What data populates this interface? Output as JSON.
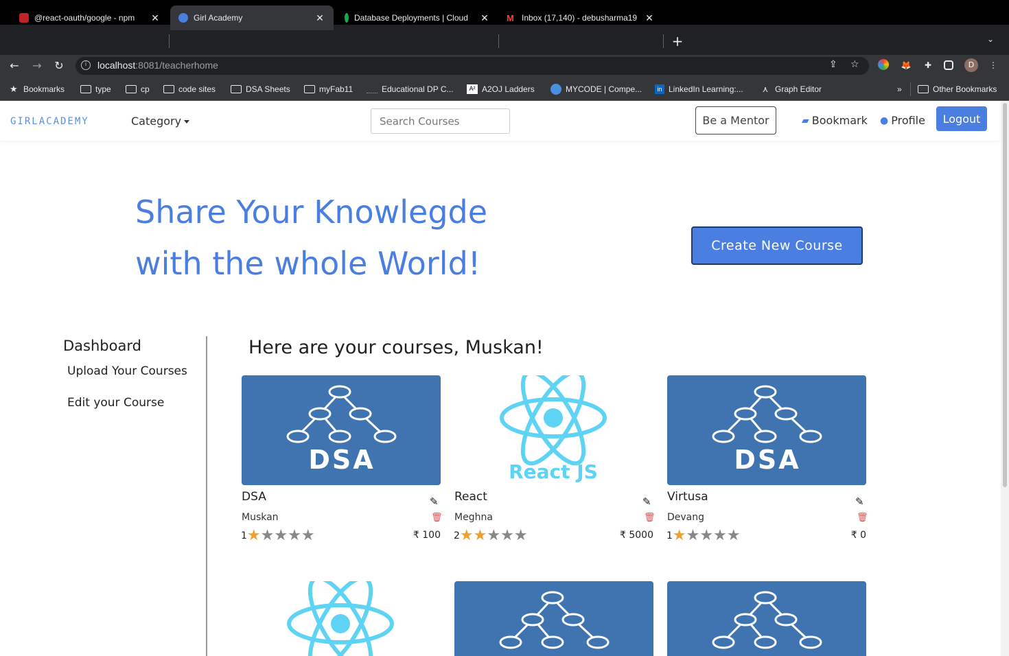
{
  "browser": {
    "tabs": [
      {
        "title": "@react-oauth/google - npm",
        "fav_color": "#c12127",
        "active": false
      },
      {
        "title": "Girl Academy",
        "fav_color": "#4a7ee0",
        "active": true
      },
      {
        "title": "Database Deployments | Cloud",
        "fav_color": "#13aa52",
        "active": false
      },
      {
        "title": "Inbox (17,140) - debusharma19",
        "fav_color": "#ea4335",
        "active": false
      }
    ],
    "url_host": "localhost",
    "url_path": ":8081/teacherhome",
    "profile_initial": "D",
    "bookmarks": [
      {
        "label": "Bookmarks",
        "icon": "star-icon"
      },
      {
        "label": "type",
        "icon": "folder-icon"
      },
      {
        "label": "cp",
        "icon": "folder-icon"
      },
      {
        "label": "code sites",
        "icon": "folder-icon"
      },
      {
        "label": "DSA Sheets",
        "icon": "folder-icon"
      },
      {
        "label": "myFab11",
        "icon": "folder-icon"
      },
      {
        "label": "Educational DP C...",
        "icon": "site-icon"
      },
      {
        "label": "A2OJ Ladders",
        "icon": "site-icon"
      },
      {
        "label": "MYCODE | Compe...",
        "icon": "site-icon"
      },
      {
        "label": "LinkedIn Learning:...",
        "icon": "linkedin-icon"
      },
      {
        "label": "Graph Editor",
        "icon": "graph-icon"
      },
      {
        "label": "Other Bookmarks",
        "icon": "folder-icon"
      }
    ],
    "more_bookmarks": "»"
  },
  "nav": {
    "logo": "GIRLACADEMY",
    "category": "Category",
    "search_placeholder": "Search Courses",
    "mentor": "Be a Mentor",
    "bookmark": "Bookmark",
    "profile": "Profile",
    "logout": "Logout"
  },
  "hero": {
    "line1": "Share Your Knowlegde",
    "line2": "with the whole World!",
    "create_button": "Create New Course"
  },
  "sidebar": {
    "title": "Dashboard",
    "items": [
      "Upload Your Courses",
      "Edit your Course"
    ]
  },
  "courses": {
    "heading": "Here are your courses, Muskan!",
    "items": [
      {
        "title": "DSA",
        "author": "Muskan",
        "rating": "1",
        "stars": 1,
        "price": "₹ 100",
        "image": "dsa"
      },
      {
        "title": "React",
        "author": "Meghna",
        "rating": "2",
        "stars": 2,
        "price": "₹ 5000",
        "image": "react"
      },
      {
        "title": "Virtusa",
        "author": "Devang",
        "rating": "1",
        "stars": 1,
        "price": "₹ 0",
        "image": "dsa"
      }
    ],
    "image_text": {
      "dsa": "DSA",
      "react": "React JS"
    }
  },
  "colors": {
    "accent": "#4a7ee0",
    "dsa_bg": "#4074b0",
    "react": "#5fd3f3",
    "star_on": "#f0a030"
  }
}
